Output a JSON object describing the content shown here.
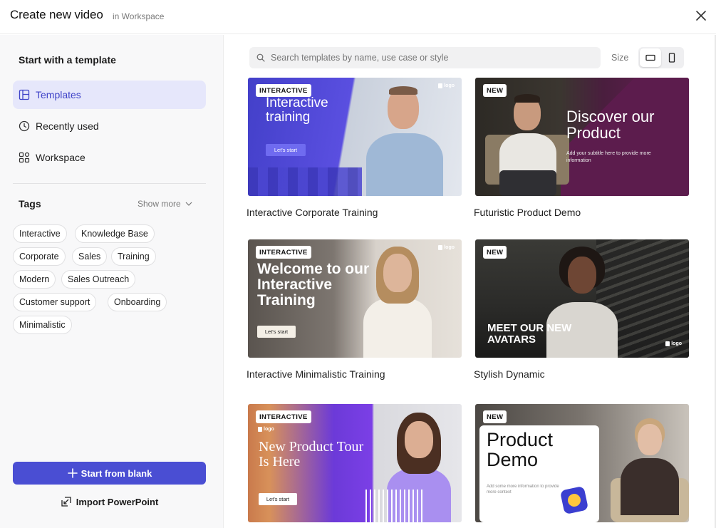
{
  "header": {
    "title": "Create new video",
    "subtitle": "in Workspace"
  },
  "sidebar": {
    "section_title": "Start with a template",
    "nav": [
      {
        "label": "Templates",
        "icon": "layout-icon",
        "active": true
      },
      {
        "label": "Recently used",
        "icon": "clock-icon",
        "active": false
      },
      {
        "label": "Workspace",
        "icon": "grid-icon",
        "active": false
      }
    ],
    "tags_title": "Tags",
    "show_more": "Show more",
    "tags": [
      "Interactive",
      "Knowledge Base",
      "Corporate",
      "Sales",
      "Training",
      "Modern",
      "Sales Outreach",
      "Customer support",
      "Onboarding",
      "Minimalistic"
    ],
    "start_blank": "Start from blank",
    "import_ppt": "Import PowerPoint"
  },
  "search": {
    "placeholder": "Search templates by name, use case or style"
  },
  "size": {
    "label": "Size",
    "options": [
      "landscape",
      "portrait"
    ],
    "selected": "landscape"
  },
  "templates": [
    {
      "title": "Interactive Corporate Training",
      "badge": "INTERACTIVE",
      "heading": "Interactive training",
      "cta": "Let's start",
      "logo": "logo"
    },
    {
      "title": "Futuristic Product Demo",
      "badge": "NEW",
      "heading": "Discover our Product",
      "subtext": "Add your subtitle here to provide more information"
    },
    {
      "title": "Interactive Minimalistic Training",
      "badge": "INTERACTIVE",
      "heading": "Welcome to our Interactive Training",
      "cta": "Let's start",
      "logo": "logo"
    },
    {
      "title": "Stylish Dynamic",
      "badge": "NEW",
      "heading": "MEET OUR NEW AVATARS",
      "logo": "logo"
    },
    {
      "title": "",
      "badge": "INTERACTIVE",
      "heading": "New Product Tour Is Here",
      "cta": "Let's start",
      "logo": "logo"
    },
    {
      "title": "",
      "badge": "NEW",
      "heading": "Product Demo",
      "subtext": "Add some more information to provide more context"
    }
  ],
  "colors": {
    "accent": "#4a4ed3",
    "active_nav_bg": "#e6e7fb",
    "active_nav_text": "#3f43c8"
  }
}
